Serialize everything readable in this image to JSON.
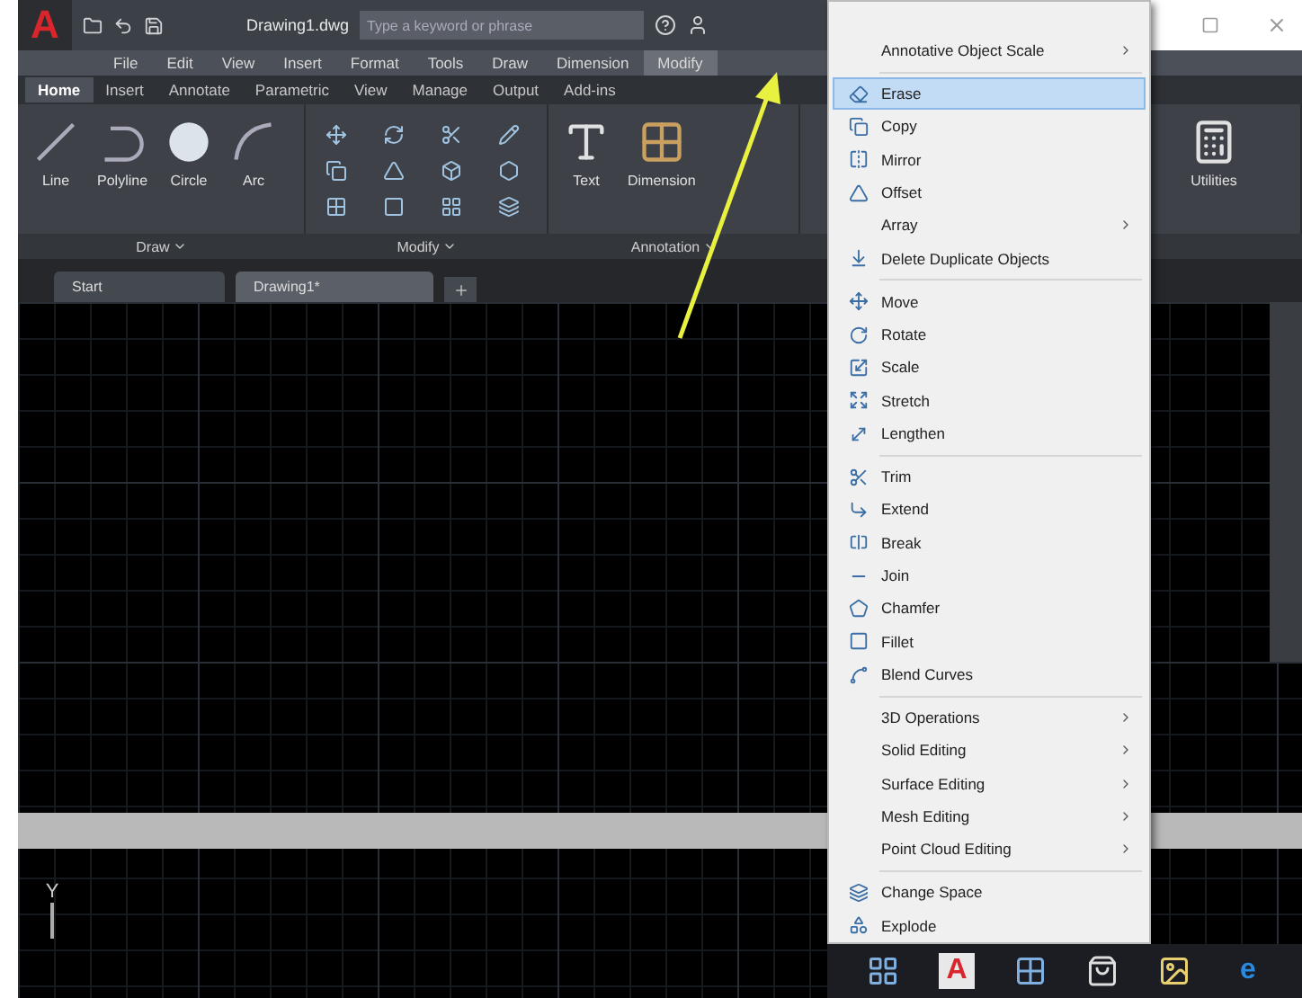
{
  "title_bar": {
    "logo": "A",
    "file_name": "Drawing1.dwg",
    "search": {
      "placeholder": "Type a keyword or phrase"
    }
  },
  "menu_bar": [
    {
      "label": "File",
      "selected": false
    },
    {
      "label": "Edit",
      "selected": false
    },
    {
      "label": "View",
      "selected": false
    },
    {
      "label": "Insert",
      "selected": false
    },
    {
      "label": "Format",
      "selected": false
    },
    {
      "label": "Tools",
      "selected": false
    },
    {
      "label": "Draw",
      "selected": false
    },
    {
      "label": "Dimension",
      "selected": false
    },
    {
      "label": "Modify",
      "selected": true
    }
  ],
  "ribbon_tabs": [
    {
      "label": "Home",
      "selected": true
    },
    {
      "label": "Insert",
      "selected": false
    },
    {
      "label": "Annotate",
      "selected": false
    },
    {
      "label": "Parametric",
      "selected": false
    },
    {
      "label": "View",
      "selected": false
    },
    {
      "label": "Manage",
      "selected": false
    },
    {
      "label": "Output",
      "selected": false
    },
    {
      "label": "Add-ins",
      "selected": false
    }
  ],
  "ribbon": {
    "draw_tools": [
      "Line",
      "Polyline",
      "Circle",
      "Arc"
    ],
    "annotation_tools": [
      "Text",
      "Dimension"
    ],
    "utilities": "Utilities",
    "panels": [
      "Draw",
      "Modify",
      "Annotation"
    ]
  },
  "file_tabs": [
    {
      "label": "Start",
      "selected": false
    },
    {
      "label": "Drawing1*",
      "selected": true
    }
  ],
  "canvas": {
    "axis_label": "Y"
  },
  "taskbar": {
    "app_badge": "A",
    "browser_badge": "e"
  },
  "context_menu": [
    {
      "kind": "plain",
      "label": "Annotative Object Scale",
      "submenu": true,
      "selected": false
    },
    {
      "kind": "separator"
    },
    {
      "kind": "tool",
      "label": "Erase",
      "submenu": false,
      "selected": true
    },
    {
      "kind": "tool",
      "label": "Copy",
      "submenu": false,
      "selected": false
    },
    {
      "kind": "tool",
      "label": "Mirror",
      "submenu": false,
      "selected": false
    },
    {
      "kind": "tool",
      "label": "Offset",
      "submenu": false,
      "selected": false
    },
    {
      "kind": "plain",
      "label": "Array",
      "submenu": true,
      "selected": false
    },
    {
      "kind": "tool",
      "label": "Delete Duplicate Objects",
      "submenu": false,
      "selected": false
    },
    {
      "kind": "separator"
    },
    {
      "kind": "tool",
      "label": "Move",
      "submenu": false,
      "selected": false
    },
    {
      "kind": "tool",
      "label": "Rotate",
      "submenu": false,
      "selected": false
    },
    {
      "kind": "tool",
      "label": "Scale",
      "submenu": false,
      "selected": false
    },
    {
      "kind": "tool",
      "label": "Stretch",
      "submenu": false,
      "selected": false
    },
    {
      "kind": "tool",
      "label": "Lengthen",
      "submenu": false,
      "selected": false
    },
    {
      "kind": "separator"
    },
    {
      "kind": "tool",
      "label": "Trim",
      "submenu": false,
      "selected": false
    },
    {
      "kind": "tool",
      "label": "Extend",
      "submenu": false,
      "selected": false
    },
    {
      "kind": "tool",
      "label": "Break",
      "submenu": false,
      "selected": false
    },
    {
      "kind": "tool",
      "label": "Join",
      "submenu": false,
      "selected": false
    },
    {
      "kind": "tool",
      "label": "Chamfer",
      "submenu": false,
      "selected": false
    },
    {
      "kind": "tool",
      "label": "Fillet",
      "submenu": false,
      "selected": false
    },
    {
      "kind": "tool",
      "label": "Blend Curves",
      "submenu": false,
      "selected": false
    },
    {
      "kind": "separator"
    },
    {
      "kind": "plain",
      "label": "3D Operations",
      "submenu": true,
      "selected": false
    },
    {
      "kind": "plain",
      "label": "Solid Editing",
      "submenu": true,
      "selected": false
    },
    {
      "kind": "plain",
      "label": "Surface Editing",
      "submenu": true,
      "selected": false
    },
    {
      "kind": "plain",
      "label": "Mesh Editing",
      "submenu": true,
      "selected": false
    },
    {
      "kind": "plain",
      "label": "Point Cloud Editing",
      "submenu": true,
      "selected": false
    },
    {
      "kind": "separator"
    },
    {
      "kind": "tool",
      "label": "Change Space",
      "submenu": false,
      "selected": false
    },
    {
      "kind": "tool",
      "label": "Explode",
      "submenu": false,
      "selected": false
    }
  ]
}
